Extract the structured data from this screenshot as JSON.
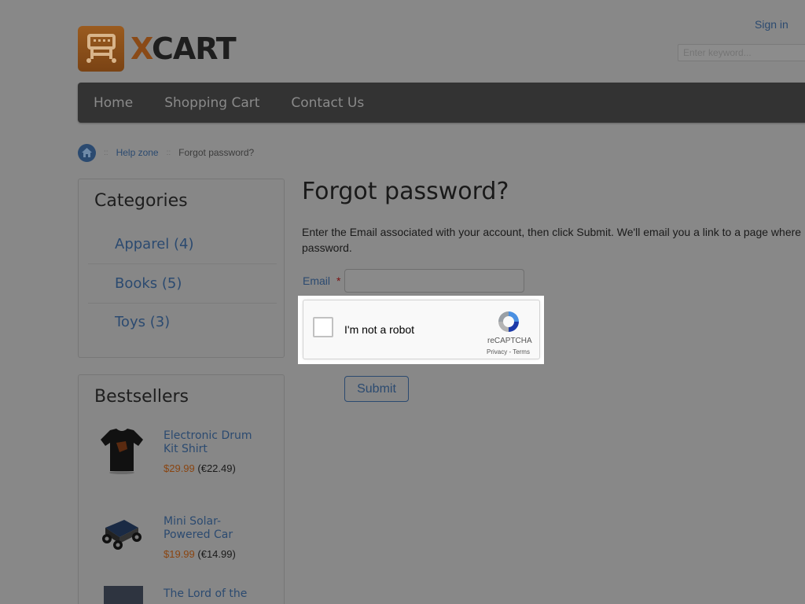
{
  "header": {
    "logo_text": "XCART",
    "sign_in": "Sign in",
    "search_placeholder": "Enter keyword..."
  },
  "nav": {
    "items": [
      {
        "label": "Home"
      },
      {
        "label": "Shopping Cart"
      },
      {
        "label": "Contact Us"
      }
    ]
  },
  "breadcrumb": {
    "sep": "::",
    "items": [
      {
        "label": "Help zone"
      },
      {
        "label": "Forgot password?"
      }
    ]
  },
  "categories": {
    "title": "Categories",
    "items": [
      {
        "label": "Apparel (4)"
      },
      {
        "label": "Books (5)"
      },
      {
        "label": "Toys (3)"
      }
    ]
  },
  "bestsellers": {
    "title": "Bestsellers",
    "items": [
      {
        "name": "Electronic Drum Kit Shirt",
        "price_usd": "$29.99",
        "price_eur": "(€22.49)"
      },
      {
        "name": "Mini Solar-Powered Car",
        "price_usd": "$19.99",
        "price_eur": "(€14.99)"
      },
      {
        "name": "The Lord of the",
        "price_usd": "",
        "price_eur": ""
      }
    ]
  },
  "main": {
    "title": "Forgot password?",
    "description": "Enter the Email associated with your account, then click Submit. We'll email you a link to a page where password.",
    "email_label": "Email",
    "required_mark": "*",
    "submit_label": "Submit"
  },
  "captcha": {
    "label": "I'm not a robot",
    "brand": "reCAPTCHA",
    "links": "Privacy - Terms"
  },
  "colors": {
    "overlay": "#888888",
    "nav_bg": "#333333",
    "link": "#2b4a70",
    "price": "#8a4511"
  }
}
